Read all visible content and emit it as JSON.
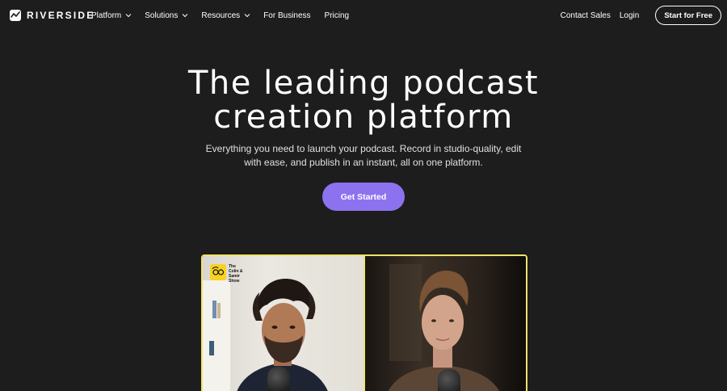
{
  "brand": {
    "name": "RIVERSIDE",
    "logo_icon": "waveform-icon"
  },
  "nav": {
    "menu": [
      {
        "label": "Platform",
        "dropdown": true
      },
      {
        "label": "Solutions",
        "dropdown": true
      },
      {
        "label": "Resources",
        "dropdown": true
      },
      {
        "label": "For Business",
        "dropdown": false
      },
      {
        "label": "Pricing",
        "dropdown": false
      }
    ],
    "contact_sales": "Contact Sales",
    "login": "Login",
    "start_free": "Start for Free"
  },
  "hero": {
    "title_line1": "The leading podcast",
    "title_line2": "creation platform",
    "subtitle_line1": "Everything you need to launch your podcast. Record in studio-quality, edit",
    "subtitle_line2": "with ease, and publish in an instant, all on one platform.",
    "cta": "Get Started"
  },
  "preview": {
    "show_badge": "The Colin & Samir Show",
    "show_badge_lines": [
      "The",
      "Colin &",
      "Samir",
      "Show"
    ],
    "frame_color": "#f0e36a"
  },
  "colors": {
    "background": "#1d1d1d",
    "accent": "#8d72f0",
    "badge_yellow": "#f7d21e"
  }
}
